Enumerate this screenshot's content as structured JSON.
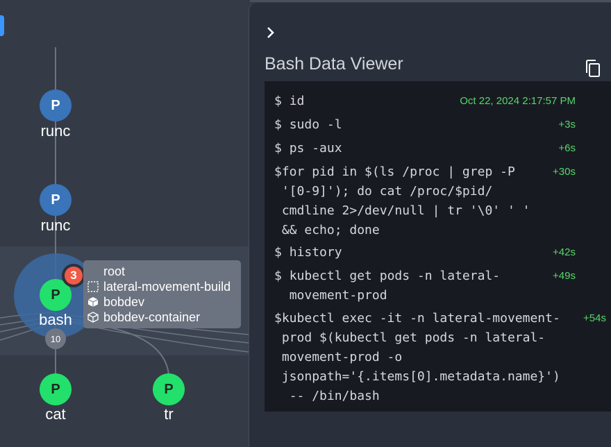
{
  "graph": {
    "nodes": [
      {
        "letter": "P",
        "label": "runc"
      },
      {
        "letter": "P",
        "label": "runc"
      },
      {
        "letter": "P",
        "label": "bash"
      },
      {
        "letter": "P",
        "label": "cat"
      },
      {
        "letter": "P",
        "label": "tr"
      }
    ],
    "selected": {
      "alert_count": "3",
      "child_count": "10"
    },
    "tooltip": {
      "rows": [
        {
          "icon": "user-icon",
          "text": "root"
        },
        {
          "icon": "namespace-icon",
          "text": "lateral-movement-build"
        },
        {
          "icon": "pod-icon",
          "text": "bobdev"
        },
        {
          "icon": "container-icon",
          "text": "bobdev-container"
        }
      ]
    }
  },
  "panel": {
    "title": "Bash Data Viewer",
    "commands": [
      {
        "prompt": "$",
        "text": " id",
        "time": "Oct 22, 2024 2:17:57 PM"
      },
      {
        "prompt": "$",
        "text": " sudo -l",
        "time": "+3s"
      },
      {
        "prompt": "$",
        "text": " ps -aux",
        "time": "+6s"
      },
      {
        "prompt": "$",
        "text": "for pid in $(ls /proc | grep -P\n'[0-9]'); do cat /proc/$pid/\ncmdline 2>/dev/null | tr '\\0' ' '\n&& echo; done",
        "time": "+30s"
      },
      {
        "prompt": "$",
        "text": " history",
        "time": "+42s"
      },
      {
        "prompt": "$",
        "text": " kubectl get pods -n lateral-\n movement-prod",
        "time": "+49s"
      },
      {
        "prompt": "$",
        "text": "kubectl exec -it -n lateral-movement-\nprod $(kubectl get pods -n lateral-\nmovement-prod -o\njsonpath='{.items[0].metadata.name}')\n -- /bin/bash",
        "time": "+54s"
      }
    ]
  },
  "colors": {
    "process_blue": "#3a74b9",
    "process_green": "#22e06b",
    "alert_red": "#f15a47",
    "timestamp_green": "#58d56b"
  }
}
